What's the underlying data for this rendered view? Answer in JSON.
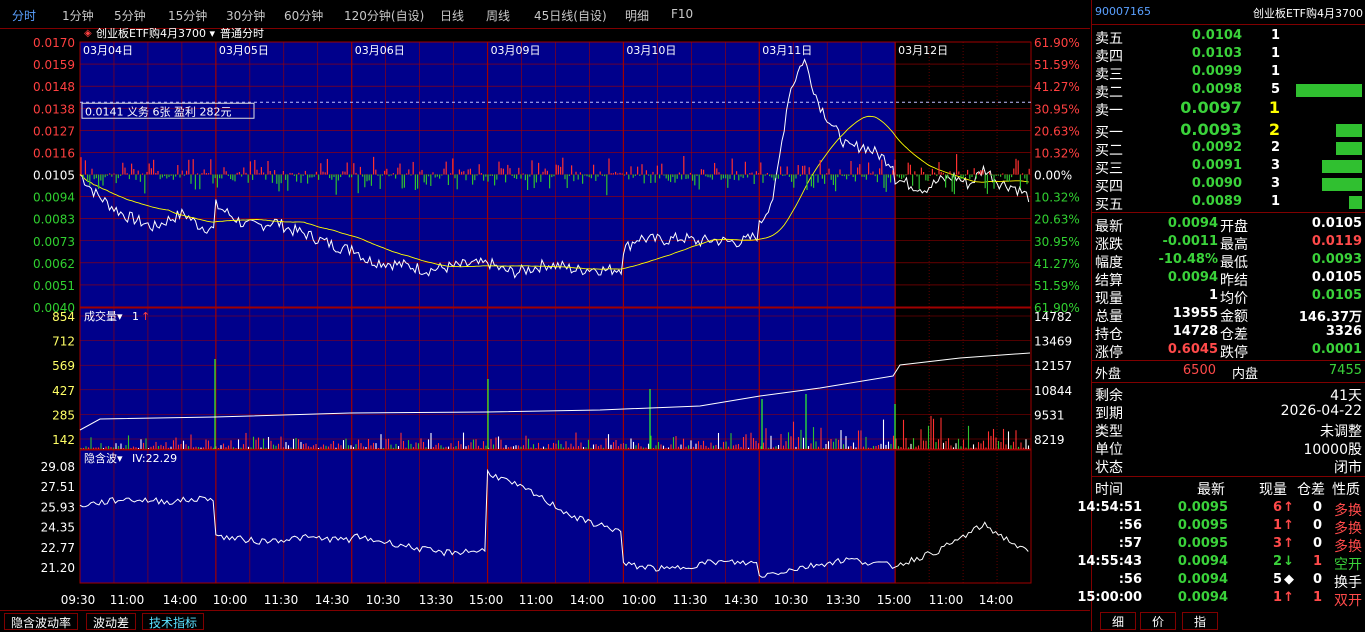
{
  "periods": [
    "分时",
    "1分钟",
    "5分钟",
    "15分钟",
    "30分钟",
    "60分钟",
    "120分钟(自设)",
    "日线",
    "周线",
    "45日线(自设)",
    "明细",
    "F10"
  ],
  "main_panel": {
    "title": "创业板ETF购4月3700",
    "mode": "普通分时",
    "dates": [
      "03月04日",
      "03月05日",
      "03月06日",
      "03月09日",
      "03月10日",
      "03月11日",
      "03月12日"
    ],
    "price_ticks": [
      "0.0170",
      "0.0159",
      "0.0148",
      "0.0138",
      "0.0127",
      "0.0116",
      "0.0105",
      "0.0094",
      "0.0083",
      "0.0073",
      "0.0062",
      "0.0051",
      "0.0040"
    ],
    "pct_ticks": [
      "61.90%",
      "51.59%",
      "41.27%",
      "30.95%",
      "20.63%",
      "10.32%",
      "0.00%",
      "10.32%",
      "20.63%",
      "30.95%",
      "41.27%",
      "51.59%",
      "61.90%"
    ],
    "annotation": "0.0141 义务  6张  盈利  282元"
  },
  "volume_panel": {
    "label": "成交量",
    "label_value": "1",
    "left_ticks": [
      "854",
      "712",
      "569",
      "427",
      "285",
      "142"
    ],
    "right_ticks": [
      "14782",
      "13469",
      "12157",
      "10844",
      "9531",
      "8219"
    ]
  },
  "iv_panel": {
    "label": "隐含波",
    "iv_text": "IV:22.29",
    "ticks": [
      "29.08",
      "27.51",
      "25.93",
      "24.35",
      "22.77",
      "21.20"
    ]
  },
  "time_axis": [
    "09:30",
    "11:00",
    "14:00",
    "10:00",
    "11:30",
    "14:30",
    "10:30",
    "13:30",
    "15:00",
    "11:00",
    "14:00",
    "10:00",
    "11:30",
    "14:30",
    "10:30",
    "13:30",
    "15:00",
    "11:00",
    "14:00"
  ],
  "bottom_tabs": [
    "隐含波动率",
    "波动差",
    "技术指标"
  ],
  "right_panel": {
    "code": "90007165",
    "name": "创业板ETF购4月3700",
    "asks": [
      {
        "label": "卖五",
        "price": "0.0104",
        "vol": "1",
        "bar": 0
      },
      {
        "label": "卖四",
        "price": "0.0103",
        "vol": "1",
        "bar": 0
      },
      {
        "label": "卖三",
        "price": "0.0099",
        "vol": "1",
        "bar": 0
      },
      {
        "label": "卖二",
        "price": "0.0098",
        "vol": "5",
        "bar": 1
      },
      {
        "label": "卖一",
        "price": "0.0097",
        "vol": "1",
        "bar": 0
      }
    ],
    "bids": [
      {
        "label": "买一",
        "price": "0.0093",
        "vol": "2",
        "bar": 0.4
      },
      {
        "label": "买二",
        "price": "0.0092",
        "vol": "2",
        "bar": 0.4
      },
      {
        "label": "买三",
        "price": "0.0091",
        "vol": "3",
        "bar": 0.6
      },
      {
        "label": "买四",
        "price": "0.0090",
        "vol": "3",
        "bar": 0.6
      },
      {
        "label": "买五",
        "price": "0.0089",
        "vol": "1",
        "bar": 0.2
      }
    ],
    "stats": [
      {
        "l1": "最新",
        "v1": "0.0094",
        "c1": "green",
        "l2": "开盘",
        "v2": "0.0105",
        "c2": "white"
      },
      {
        "l1": "涨跌",
        "v1": "-0.0011",
        "c1": "green",
        "l2": "最高",
        "v2": "0.0119",
        "c2": "red"
      },
      {
        "l1": "幅度",
        "v1": "-10.48%",
        "c1": "green",
        "l2": "最低",
        "v2": "0.0093",
        "c2": "green"
      },
      {
        "l1": "结算",
        "v1": "0.0094",
        "c1": "green",
        "l2": "昨结",
        "v2": "0.0105",
        "c2": "white"
      },
      {
        "l1": "现量",
        "v1": "1",
        "c1": "white",
        "l2": "均价",
        "v2": "0.0105",
        "c2": "green"
      },
      {
        "l1": "总量",
        "v1": "13955",
        "c1": "white",
        "l2": "金额",
        "v2": "146.37万",
        "c2": "white"
      },
      {
        "l1": "持仓",
        "v1": "14728",
        "c1": "white",
        "l2": "仓差",
        "v2": "3326",
        "c2": "white"
      },
      {
        "l1": "涨停",
        "v1": "0.6045",
        "c1": "red",
        "l2": "跌停",
        "v2": "0.0001",
        "c2": "green"
      }
    ],
    "outer": {
      "label": "外盘",
      "value": "6500"
    },
    "inner": {
      "label": "内盘",
      "value": "7455"
    },
    "info": [
      {
        "label": "剩余",
        "value": "41天"
      },
      {
        "label": "到期",
        "value": "2026-04-22"
      },
      {
        "label": "类型",
        "value": "未调整"
      },
      {
        "label": "单位",
        "value": "10000股"
      },
      {
        "label": "状态",
        "value": "闭市"
      }
    ],
    "ticks_header": [
      "时间",
      "最新",
      "现量",
      "仓差",
      "性质"
    ],
    "ticks": [
      {
        "time": "14:54:51",
        "price": "0.0095",
        "vol": "6",
        "arrow": "↑",
        "ac": "red",
        "diff": "0",
        "nature": "多换",
        "nc": "red"
      },
      {
        "time": ":56",
        "price": "0.0095",
        "vol": "1",
        "arrow": "↑",
        "ac": "red",
        "diff": "0",
        "nature": "多换",
        "nc": "red"
      },
      {
        "time": ":57",
        "price": "0.0095",
        "vol": "3",
        "arrow": "↑",
        "ac": "red",
        "diff": "0",
        "nature": "多换",
        "nc": "red"
      },
      {
        "time": "14:55:43",
        "price": "0.0094",
        "vol": "2",
        "arrow": "↓",
        "ac": "green",
        "diff": "1",
        "nature": "空开",
        "nc": "green"
      },
      {
        "time": ":56",
        "price": "0.0094",
        "vol": "5",
        "arrow": "◆",
        "ac": "white",
        "diff": "0",
        "nature": "换手",
        "nc": "white"
      },
      {
        "time": "15:00:00",
        "price": "0.0094",
        "vol": "1",
        "arrow": "↑",
        "ac": "red",
        "diff": "1",
        "nature": "双开",
        "nc": "red"
      }
    ],
    "tabs": [
      "细",
      "价",
      "指"
    ]
  },
  "colors": {
    "panel_bg": "#00008b",
    "grid": "#a00000",
    "price_line": "#ffffff",
    "avg_line": "#ffff00",
    "up": "#ff3030",
    "down": "#30c030"
  }
}
